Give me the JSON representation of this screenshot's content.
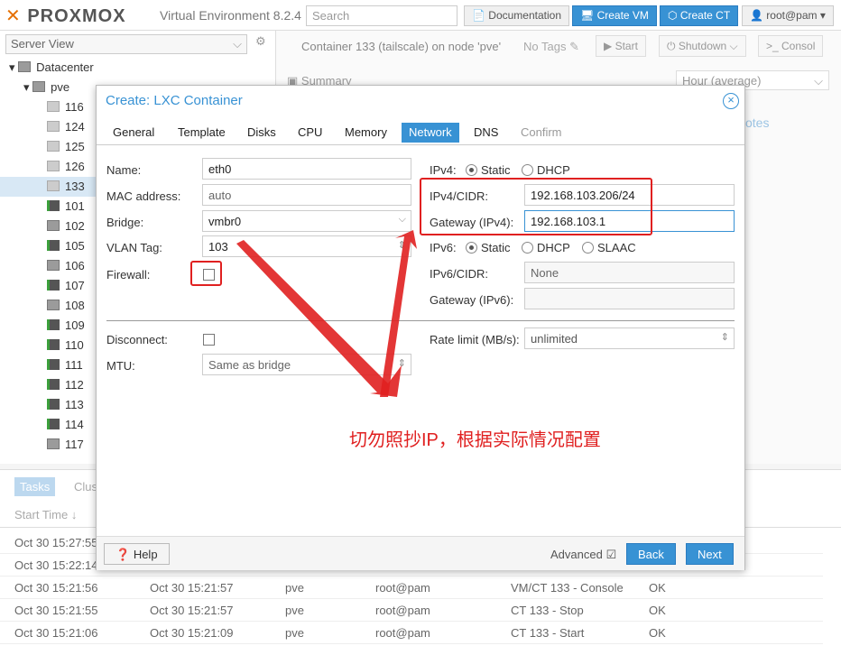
{
  "header": {
    "brand": "PROXMOX",
    "version": "Virtual Environment 8.2.4",
    "search_placeholder": "Search",
    "docs": "Documentation",
    "create_vm": "Create VM",
    "create_ct": "Create CT",
    "user": "root@pam"
  },
  "left": {
    "view": "Server View",
    "datacenter": "Datacenter",
    "node": "pve",
    "items": [
      "116",
      "124",
      "125",
      "126",
      "133",
      "101",
      "102",
      "105",
      "106",
      "107",
      "108",
      "109",
      "110",
      "111",
      "112",
      "113",
      "114",
      "117"
    ]
  },
  "content": {
    "title": "Container 133 (tailscale) on node 'pve'",
    "tags": "No Tags",
    "start": "Start",
    "shutdown": "Shutdown",
    "console": "Consol",
    "summary": "Summary",
    "timeframe": "Hour (average)",
    "notes": "otes"
  },
  "tasks": {
    "tab": "Tasks",
    "cluster_tab": "Clus",
    "start_time_header": "Start Time",
    "rows": [
      {
        "start": "Oct 30 15:27:55",
        "end": "",
        "node": "",
        "user": "",
        "desc": "",
        "status": ""
      },
      {
        "start": "Oct 30 15:22:14",
        "end": "",
        "node": "",
        "user": "",
        "desc": "",
        "status": ""
      },
      {
        "start": "Oct 30 15:21:56",
        "end": "Oct 30 15:21:57",
        "node": "pve",
        "user": "root@pam",
        "desc": "VM/CT 133 - Console",
        "status": "OK"
      },
      {
        "start": "Oct 30 15:21:55",
        "end": "Oct 30 15:21:57",
        "node": "pve",
        "user": "root@pam",
        "desc": "CT 133 - Stop",
        "status": "OK"
      },
      {
        "start": "Oct 30 15:21:06",
        "end": "Oct 30 15:21:09",
        "node": "pve",
        "user": "root@pam",
        "desc": "CT 133 - Start",
        "status": "OK"
      }
    ]
  },
  "modal": {
    "title": "Create: LXC Container",
    "tabs": [
      "General",
      "Template",
      "Disks",
      "CPU",
      "Memory",
      "Network",
      "DNS",
      "Confirm"
    ],
    "name_label": "Name:",
    "name": "eth0",
    "mac_label": "MAC address:",
    "mac": "auto",
    "bridge_label": "Bridge:",
    "bridge": "vmbr0",
    "vlan_label": "VLAN Tag:",
    "vlan": "103",
    "firewall_label": "Firewall:",
    "ipv4_label": "IPv4:",
    "static": "Static",
    "dhcp": "DHCP",
    "slaac": "SLAAC",
    "ipv4cidr_label": "IPv4/CIDR:",
    "ipv4cidr": "192.168.103.206/24",
    "gw4_label": "Gateway (IPv4):",
    "gw4": "192.168.103.1",
    "ipv6_label": "IPv6:",
    "ipv6cidr_label": "IPv6/CIDR:",
    "ipv6cidr": "None",
    "gw6_label": "Gateway (IPv6):",
    "gw6": "",
    "disconnect_label": "Disconnect:",
    "mtu_label": "MTU:",
    "mtu": "Same as bridge",
    "rate_label": "Rate limit (MB/s):",
    "rate": "unlimited",
    "help": "Help",
    "advanced": "Advanced",
    "back": "Back",
    "next": "Next"
  },
  "annotation": "切勿照抄IP，根据实际情况配置",
  "colors": {
    "accent": "#3892d4",
    "annotation": "#e02020",
    "brand_orange": "#e57000"
  }
}
